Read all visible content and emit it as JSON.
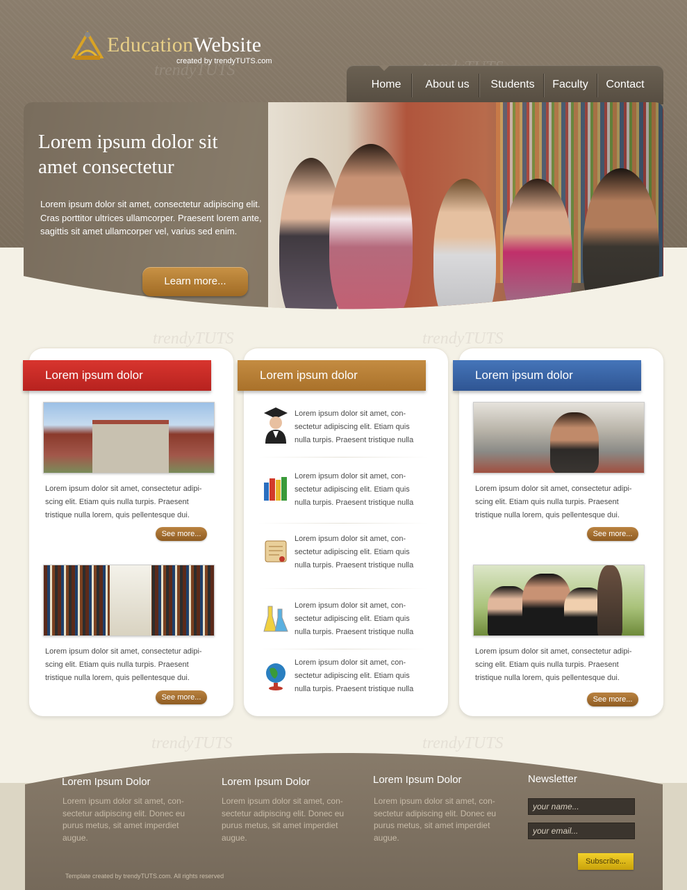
{
  "logo": {
    "part1": "Education",
    "part2": "Website",
    "sub": "created by trendyTUTS.com"
  },
  "nav": {
    "items": [
      "Home",
      "About us",
      "Students",
      "Faculty",
      "Contact"
    ],
    "active": "Home"
  },
  "hero": {
    "title": "Lorem ipsum dolor sit amet consectetur",
    "text": "Lorem ipsum dolor sit amet, consectetur adipiscing elit. Cras porttitor ultrices ullamcorper. Praesent lorem ante, sagittis sit amet ullamcorper vel, varius sed enim.",
    "button": "Learn more..."
  },
  "columns": [
    {
      "heading": "Lorem ipsum dolor",
      "color": "#c62a26",
      "blocks": [
        {
          "text": "Lorem ipsum dolor sit amet, consectetur adipi-scing elit. Etiam quis nulla turpis. Praesent tristique nulla lorem, quis pellentesque dui.",
          "button": "See more..."
        },
        {
          "text": "Lorem ipsum dolor sit amet, consectetur adipi-scing elit. Etiam quis nulla turpis. Praesent tristique nulla lorem, quis pellentesque dui.",
          "button": "See more..."
        }
      ]
    },
    {
      "heading": "Lorem ipsum dolor",
      "color": "#b87e35",
      "items": [
        {
          "icon": "graduate-icon",
          "text": "Lorem ipsum dolor sit amet, con-sectetur adipiscing elit. Etiam quis nulla turpis. Praesent tristique nulla"
        },
        {
          "icon": "books-icon",
          "text": "Lorem ipsum dolor sit amet, con-sectetur adipiscing elit. Etiam quis nulla turpis. Praesent tristique nulla"
        },
        {
          "icon": "scroll-icon",
          "text": "Lorem ipsum dolor sit amet, con-sectetur adipiscing elit. Etiam quis nulla turpis. Praesent tristique nulla"
        },
        {
          "icon": "flask-icon",
          "text": "Lorem ipsum dolor sit amet, con-sectetur adipiscing elit. Etiam quis nulla turpis. Praesent tristique nulla"
        },
        {
          "icon": "globe-icon",
          "text": "Lorem ipsum dolor sit amet, con-sectetur adipiscing elit. Etiam quis nulla turpis. Praesent tristique nulla"
        }
      ]
    },
    {
      "heading": "Lorem ipsum dolor",
      "color": "#3b64a3",
      "blocks": [
        {
          "text": "Lorem ipsum dolor sit amet, consectetur adipi-scing elit. Etiam quis nulla turpis. Praesent tristique nulla lorem, quis pellentesque dui.",
          "button": "See more..."
        },
        {
          "text": "Lorem ipsum dolor sit amet, consectetur adipi-scing elit. Etiam quis nulla turpis. Praesent tristique nulla lorem, quis pellentesque dui.",
          "button": "See more..."
        }
      ]
    }
  ],
  "footer": {
    "cols": [
      {
        "heading": "Lorem Ipsum Dolor",
        "text": "Lorem ipsum dolor sit amet, con-sectetur adipiscing elit. Donec eu purus metus, sit amet imperdiet augue."
      },
      {
        "heading": "Lorem Ipsum Dolor",
        "text": "Lorem ipsum dolor sit amet, con-sectetur adipiscing elit. Donec eu purus metus, sit amet imperdiet augue."
      },
      {
        "heading": "Lorem Ipsum Dolor",
        "text": "Lorem ipsum dolor sit amet, con-sectetur adipiscing elit. Donec eu purus metus, sit amet imperdiet augue."
      }
    ],
    "newsletter": {
      "heading": "Newsletter",
      "name_placeholder": "your name...",
      "email_placeholder": "your email...",
      "button": "Subscribe..."
    },
    "copyright": "Template created by trendyTUTS.com. All rights reserved"
  },
  "watermark": "trendyTUTS"
}
